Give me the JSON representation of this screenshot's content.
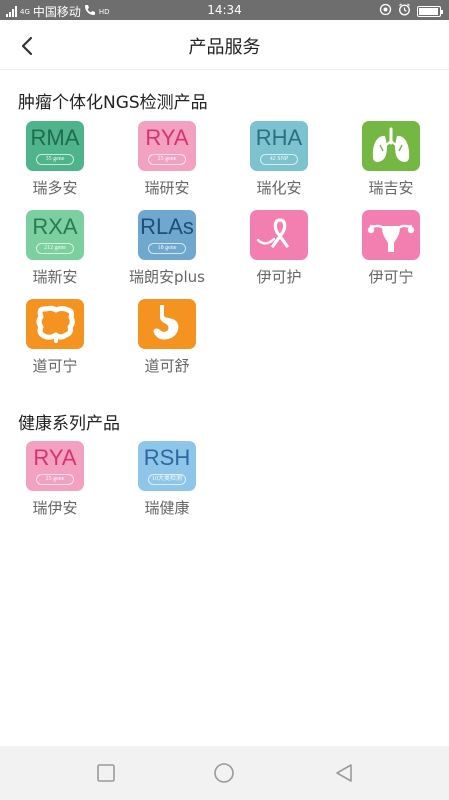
{
  "status_bar": {
    "carrier": "中国移动",
    "network": "4G",
    "call_badge": "HD",
    "time": "14:34",
    "battery_level": 0.85
  },
  "header": {
    "title": "产品服务"
  },
  "sections": [
    {
      "title": "肿瘤个体化NGS检测产品",
      "products": [
        {
          "code": "RMA",
          "subtitle": "35 gene",
          "name": "瑞多安",
          "color": "#4fb48c"
        },
        {
          "code": "RYA",
          "subtitle": "25 gene",
          "name": "瑞研安",
          "color": "#f2a1c0"
        },
        {
          "code": "RHA",
          "subtitle": "42 SNP",
          "name": "瑞化安",
          "color": "#7cc3cf"
        },
        {
          "code": "",
          "subtitle": "",
          "name": "瑞吉安",
          "color": "#74b843",
          "icon": "lungs-icon"
        },
        {
          "code": "RXA",
          "subtitle": "212 gene",
          "name": "瑞新安",
          "color": "#7ccf9f"
        },
        {
          "code": "RLAs",
          "subtitle": "18 gene",
          "name": "瑞朗安plus",
          "color": "#6fa8cf"
        },
        {
          "code": "",
          "subtitle": "",
          "name": "伊可护",
          "color": "#f27fb0",
          "icon": "ribbon-icon"
        },
        {
          "code": "",
          "subtitle": "",
          "name": "伊可宁",
          "color": "#f27fb0",
          "icon": "uterus-icon"
        },
        {
          "code": "",
          "subtitle": "",
          "name": "道可宁",
          "color": "#f4931f",
          "icon": "intestine-icon"
        },
        {
          "code": "",
          "subtitle": "",
          "name": "道可舒",
          "color": "#f4931f",
          "icon": "stomach-icon"
        }
      ]
    },
    {
      "title": "健康系列产品",
      "products": [
        {
          "code": "RYA",
          "subtitle": "25 gene",
          "name": "瑞伊安",
          "color": "#f2a1c0"
        },
        {
          "code": "RSH",
          "subtitle": "10大类检测",
          "name": "瑞健康",
          "color": "#8ec6ea"
        }
      ]
    }
  ],
  "code_colors": {
    "RMA": "#1f6b50",
    "RYA": "#d8336e",
    "RHA": "#2b6f86",
    "RXA": "#2a7a55",
    "RLAs": "#1e4f7a",
    "RSH": "#2a6aa0"
  }
}
